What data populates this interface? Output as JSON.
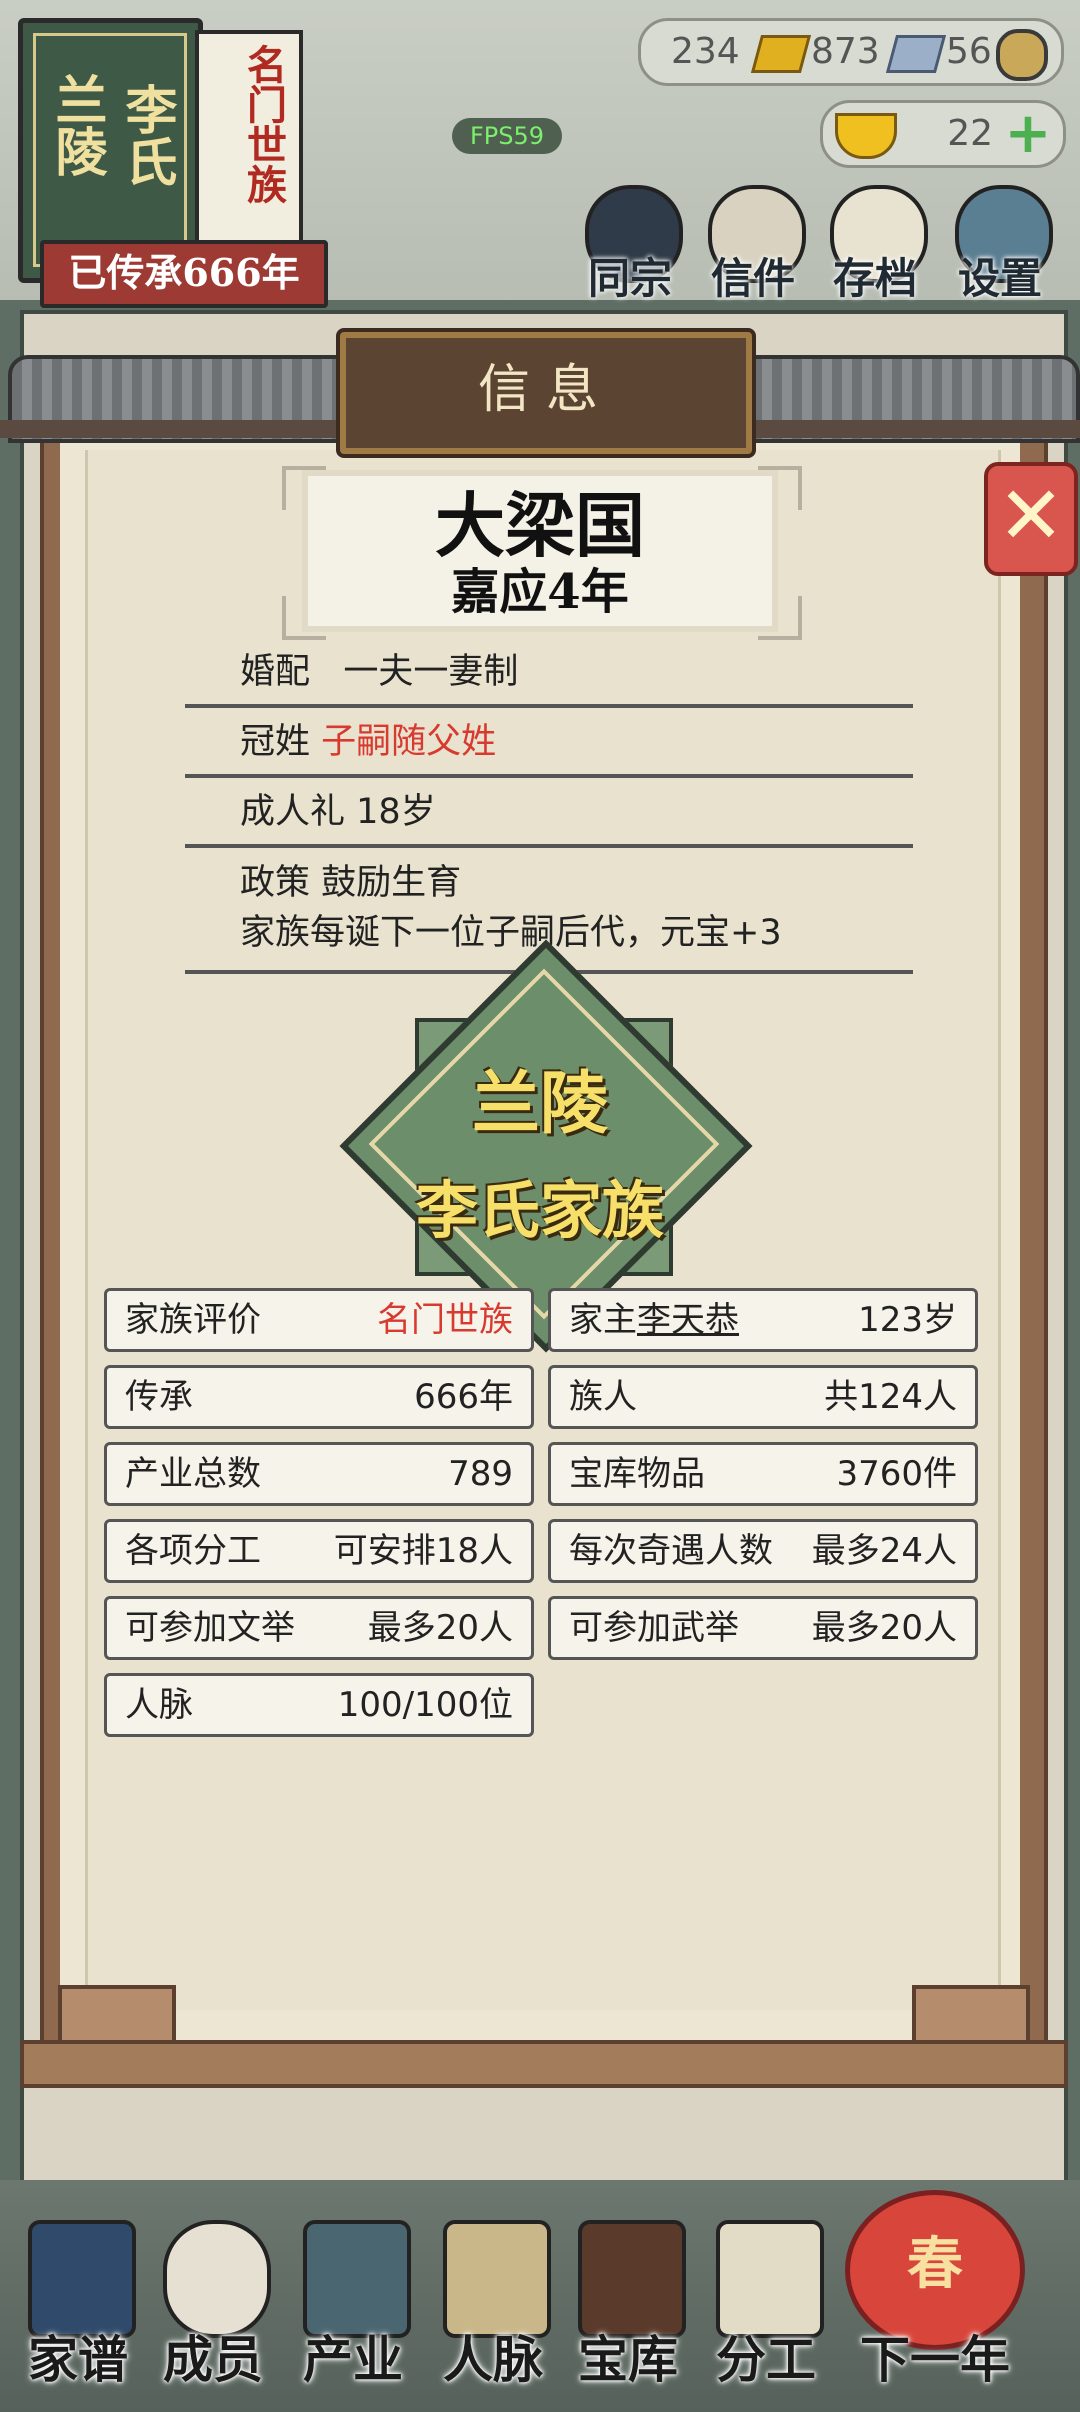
{
  "hud": {
    "fps": "FPS59",
    "gold": "234",
    "silver": "873",
    "coin": "56",
    "yuanbao": "22"
  },
  "family": {
    "banner_left": "兰陵",
    "banner_right": "李氏",
    "rank_banner": "名门世族",
    "legacy": "已传承666年"
  },
  "top_menu": [
    "同宗",
    "信件",
    "存档",
    "设置"
  ],
  "modal": {
    "title": "信息",
    "country": "大梁国",
    "era": "嘉应4年",
    "rows": {
      "marriage_label": "婚配",
      "marriage_value": "一夫一妻制",
      "surname_label": "冠姓",
      "surname_value": "子嗣随父姓",
      "adult_label": "成人礼",
      "adult_value": "18岁",
      "policy_label": "政策",
      "policy_value": "鼓励生育",
      "policy_desc": "家族每诞下一位子嗣后代，元宝+3"
    },
    "emblem": {
      "line1": "兰陵",
      "line2": "李氏家族"
    },
    "stats": {
      "rating_label": "家族评价",
      "rating_value": "名门世族",
      "head_label": "家主",
      "head_name": "李天恭",
      "head_age": "123岁",
      "legacy_label": "传承",
      "legacy_value": "666年",
      "clan_label": "族人",
      "clan_value": "共124人",
      "industry_label": "产业总数",
      "industry_value": "789",
      "vault_label": "宝库物品",
      "vault_value": "3760件",
      "labor_label": "各项分工",
      "labor_value": "可安排18人",
      "encounter_label": "每次奇遇人数",
      "encounter_value": "最多24人",
      "civil_label": "可参加文举",
      "civil_value": "最多20人",
      "military_label": "可参加武举",
      "military_value": "最多20人",
      "network_label": "人脉",
      "network_value": "100/100位"
    }
  },
  "bottom_nav": [
    "家谱",
    "成员",
    "产业",
    "人脉",
    "宝库",
    "分工",
    "下一年"
  ],
  "next_year_lantern": "春",
  "colors": {
    "accent_red": "#d83a30",
    "paper": "#e8e2cf",
    "emblem_green": "#6c8e6a",
    "emblem_text": "#f6e06a"
  }
}
